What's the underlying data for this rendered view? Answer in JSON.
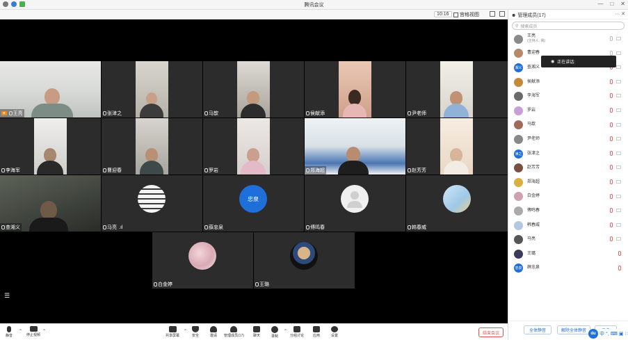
{
  "window": {
    "title": "腾讯会议"
  },
  "toolbar": {
    "time": "10:16",
    "view_label": "宫格视图"
  },
  "video_tiles": [
    {
      "name": "王亮",
      "host": true
    },
    {
      "name": "张津之"
    },
    {
      "name": "马歆"
    },
    {
      "name": "侯献添"
    },
    {
      "name": "尹老师"
    },
    {
      "name": "李海军"
    },
    {
      "name": "曹迎春"
    },
    {
      "name": "罗岩"
    },
    {
      "name": "郑海超"
    },
    {
      "name": "赵芳芳"
    },
    {
      "name": "查湘义"
    },
    {
      "name": "马亮"
    },
    {
      "name": "薛忠泉",
      "avatar_text": "忠泉"
    },
    {
      "name": "傅鸣春"
    },
    {
      "name": "韩春威"
    },
    {
      "name": "白金婷"
    },
    {
      "name": "王璐"
    }
  ],
  "sidebar": {
    "title": "管理成员(17)",
    "search_placeholder": "搜索成员",
    "tooltip": "正在讲话:",
    "members": [
      {
        "name": "王亮",
        "sub": "(主持人, 我)"
      },
      {
        "name": "曹迎春",
        "sub": ""
      },
      {
        "name": "查湘义",
        "sub": "",
        "avatar_text": "湘义"
      },
      {
        "name": "侯献添",
        "sub": ""
      },
      {
        "name": "李海军",
        "sub": ""
      },
      {
        "name": "罗岩",
        "sub": ""
      },
      {
        "name": "马歆",
        "sub": ""
      },
      {
        "name": "尹老师",
        "sub": ""
      },
      {
        "name": "张津之",
        "sub": "",
        "avatar_text": "津之"
      },
      {
        "name": "赵芳芳",
        "sub": ""
      },
      {
        "name": "郑海超",
        "sub": ""
      },
      {
        "name": "白金婷",
        "sub": ""
      },
      {
        "name": "傅鸣春",
        "sub": ""
      },
      {
        "name": "韩春威",
        "sub": ""
      },
      {
        "name": "马亮",
        "sub": ""
      },
      {
        "name": "王璐",
        "sub": ""
      },
      {
        "name": "薛忠泉",
        "sub": "",
        "avatar_text": "忠泉"
      }
    ],
    "footer_buttons": [
      "全体静音",
      "解除全体静音",
      "更多"
    ],
    "ime": {
      "logo": "du",
      "lang": "中"
    }
  },
  "bottombar": {
    "left": [
      {
        "label": "静音"
      },
      {
        "label": "停止视频"
      }
    ],
    "center": [
      {
        "label": "共享屏幕"
      },
      {
        "label": "安全"
      },
      {
        "label": "邀请"
      },
      {
        "label": "管理成员(17)"
      },
      {
        "label": "聊天"
      },
      {
        "label": "录制"
      },
      {
        "label": "分组讨论"
      },
      {
        "label": "应用"
      },
      {
        "label": "设置"
      }
    ],
    "end_label": "结束会议"
  },
  "colors": {
    "accent": "#1e6fd9",
    "end": "#e05050",
    "host_badge": "#f08a24",
    "mute_red": "#e06666"
  }
}
